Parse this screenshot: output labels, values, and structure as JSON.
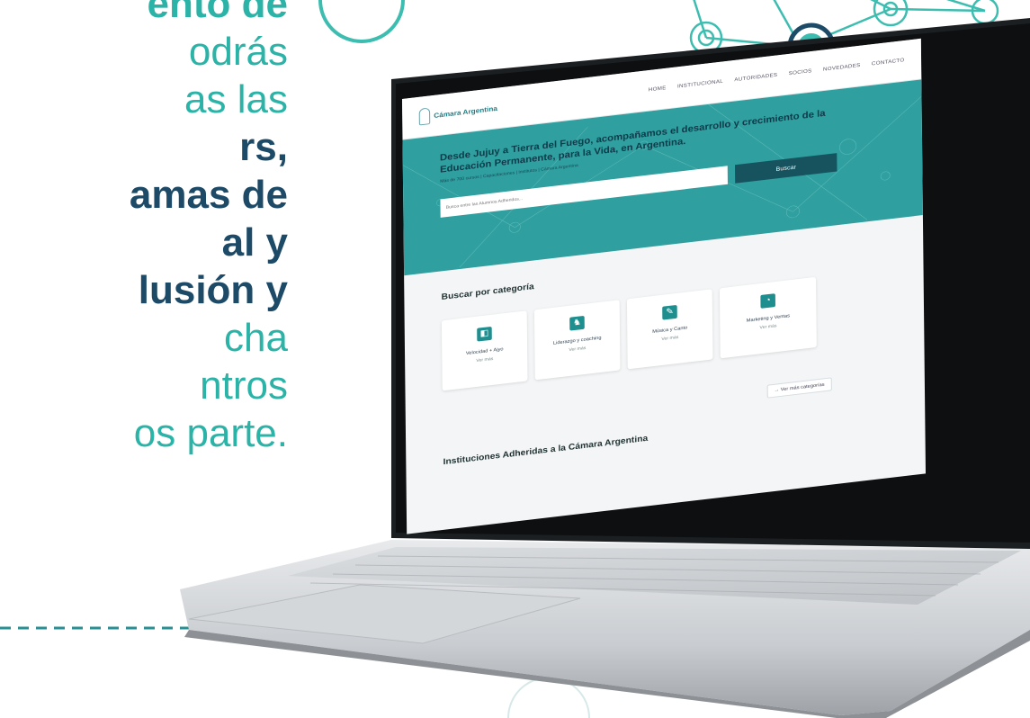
{
  "promo": {
    "lines": [
      {
        "text": "ento de",
        "bold": true,
        "color": "#2bb3a7"
      },
      {
        "text": "odrás",
        "bold": false
      },
      {
        "text": "as las",
        "bold": false
      },
      {
        "text": "rs,",
        "bold": true
      },
      {
        "text": "amas de",
        "bold": true
      },
      {
        "text": "al y",
        "bold": true
      },
      {
        "text": "lusión y",
        "bold": true
      },
      {
        "text": "cha",
        "bold": false
      },
      {
        "text": "ntros",
        "bold": false
      },
      {
        "text": "os parte.",
        "bold": false
      }
    ]
  },
  "site": {
    "logo_text": "Cámara Argentina",
    "nav": [
      "HOME",
      "INSTITUCIONAL",
      "AUTORIDADES",
      "SOCIOS",
      "NOVEDADES",
      "CONTACTO"
    ],
    "hero": {
      "title": "Desde Jujuy a Tierra del Fuego, acompañamos el desarrollo y crecimiento de la Educación Permanente, para la Vida, en Argentina.",
      "subtitle": "Más de 700 cursos | Capacitaciones | Institutos | Cámara Argentina",
      "search_placeholder": "Busca entre las Alumnos Adheridos...",
      "search_button": "Buscar"
    },
    "categories": {
      "title": "Buscar por categoría",
      "items": [
        {
          "label": "Velocidad + Ajyo",
          "more": "Ver más",
          "icon": "building-icon",
          "glyph": "◧"
        },
        {
          "label": "Liderazgo y coaching",
          "more": "Ver más",
          "icon": "chess-icon",
          "glyph": "♞"
        },
        {
          "label": "Música y Canto",
          "more": "Ver más",
          "icon": "microphone-icon",
          "glyph": "✎"
        },
        {
          "label": "Marketing y Ventas",
          "more": "Ver más",
          "icon": "pie-chart-icon",
          "glyph": "◔"
        }
      ],
      "more_button": "→ Ver más categorías"
    },
    "institutions_title": "Instituciones Adheridas a la Cámara Argentina"
  },
  "colors": {
    "teal": "#2bb3a7",
    "navy": "#1d4a66",
    "hero_teal": "#2f9f9f",
    "button_dark": "#16535f",
    "icon_teal": "#1f8e8e"
  }
}
